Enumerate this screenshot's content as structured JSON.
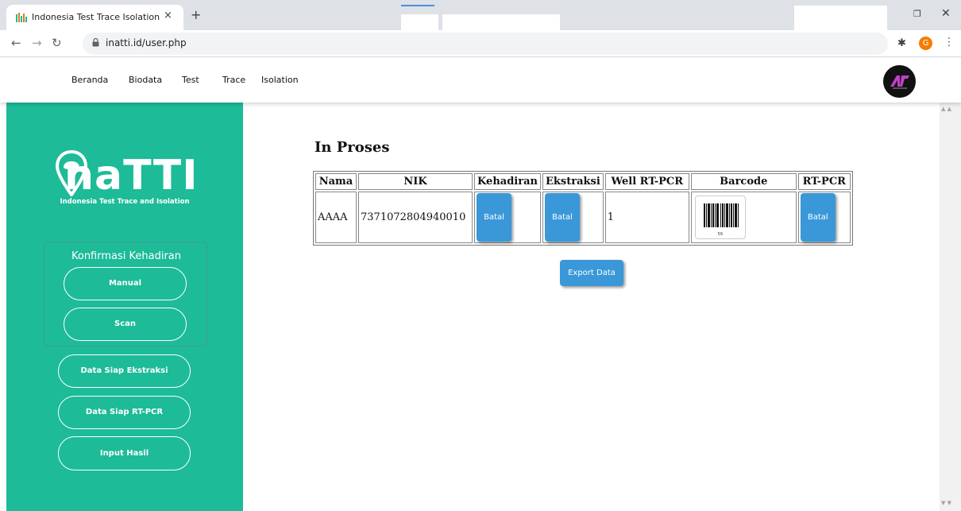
{
  "browser": {
    "tab_title": "Indonesia Test Trace Isolation",
    "tab_close": "×",
    "new_tab": "+",
    "url": "inatti.id/user.php",
    "profile_initial": "G",
    "restore_glyph": "❐",
    "close_glyph": "✕"
  },
  "nav": {
    "items": [
      "Beranda",
      "Biodata",
      "Test",
      "Trace",
      "Isolation"
    ]
  },
  "sidebar": {
    "brand": "naTTI",
    "brand_sub": "Indonesia Test Trace and Isolation",
    "konfirmasi_title": "Konfirmasi Kehadiran",
    "manual_label": "Manual",
    "scan_label": "Scan",
    "siap_ekstraksi_label": "Data Siap Ekstraksi",
    "siap_rtpcr_label": "Data Siap RT-PCR",
    "input_hasil_label": "Input Hasil",
    "accent": "#1dbb98"
  },
  "main": {
    "heading": "In Proses",
    "table": {
      "headers": [
        "Nama",
        "NIK",
        "Kehadiran",
        "Ekstraksi",
        "Well RT-PCR",
        "Barcode",
        "RT-PCR"
      ],
      "rows": [
        {
          "nama": "AAAA",
          "nik": "7371072804940010",
          "kehadiran_btn": "Batal",
          "ekstraksi_btn": "Batal",
          "well": "1",
          "barcode_text": "59",
          "rtpcr_btn": "Batal"
        }
      ]
    },
    "export_label": "Export Data",
    "button_color": "#3a98d8"
  }
}
